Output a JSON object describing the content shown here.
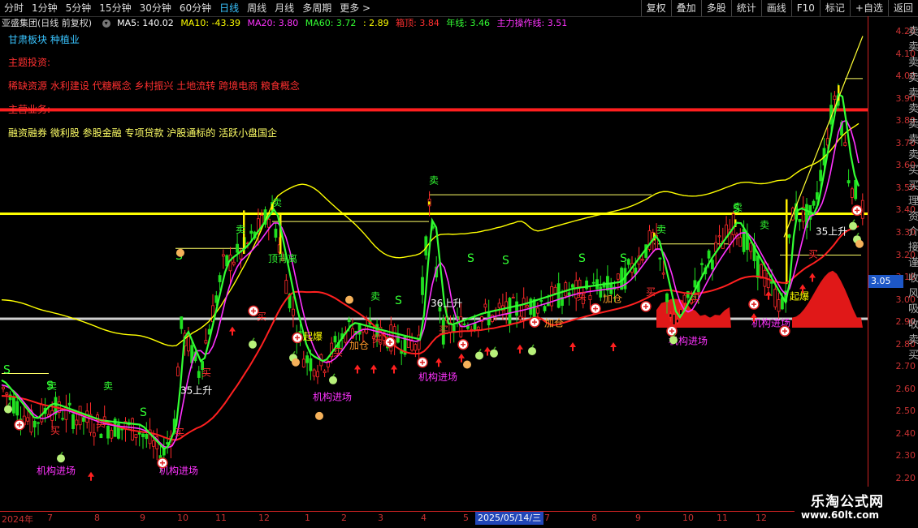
{
  "toolbar": {
    "tabs": [
      "分时",
      "1分钟",
      "5分钟",
      "15分钟",
      "30分钟",
      "60分钟",
      "日线",
      "周线",
      "月线",
      "多周期",
      "更多 >"
    ],
    "active_tab": "日线",
    "tools": [
      "复权",
      "叠加",
      "多股",
      "统计",
      "画线",
      "F10",
      "标记",
      "+自选",
      "返回"
    ]
  },
  "legend": {
    "stock": "亚盛集团(日线 前复权)",
    "ma5": "MA5: 140.02",
    "ma10": "MA10: -43.39",
    "ma20": "MA20: 3.80",
    "ma60": "MA60: 3.72",
    "extra": ": 2.89",
    "box_top": "箱顶: 3.84",
    "year_line": "年线: 3.46",
    "main_line": "主力操作线: 3.51"
  },
  "info": {
    "sector": "甘肃板块 种植业",
    "theme_label": "主题投资:",
    "themes": "稀缺资源 水利建设 代糖概念 乡村振兴 土地流转 跨境电商 粮食概念",
    "business_label": "主营业务:",
    "business": "融资融券 微利股 参股金融 专项贷款 沪股通标的 活跃小盘国企"
  },
  "annotations": {
    "institution_entry": "机构进场",
    "buy": "买",
    "sell": "卖",
    "add_position": "加仓",
    "explode": "起爆",
    "top_divergence": "顶背离",
    "rise_35": "35上升",
    "rise_36": "36上升",
    "s_mark": "S"
  },
  "price_axis": {
    "ticks": [
      "4.20",
      "4.10",
      "4.00",
      "3.90",
      "3.80",
      "3.70",
      "3.60",
      "3.50",
      "3.40",
      "3.30",
      "3.20",
      "3.10",
      "3.00",
      "2.90",
      "2.80",
      "2.70",
      "2.60",
      "2.50",
      "2.40",
      "2.30",
      "2.20"
    ],
    "current_price": "3.05",
    "side_chars": [
      "卖",
      "卖",
      "卖",
      "卖",
      "卖",
      "卖",
      "卖",
      "卖",
      "卖",
      "买",
      "买",
      "理",
      "资",
      "介",
      "接",
      "谨",
      "收",
      "风",
      "吸",
      "收",
      "卖",
      "买"
    ]
  },
  "date_axis": {
    "labels": [
      "2024年",
      "7",
      "8",
      "9",
      "10",
      "11",
      "12",
      "1",
      "2",
      "3",
      "4",
      "5",
      "2025/05/14/三",
      "7",
      "8",
      "9",
      "10",
      "11",
      "12"
    ],
    "selected_date": "2025/05/14/三"
  },
  "watermark": {
    "name": "乐淘公式网",
    "url": "www.60lt.com"
  },
  "colors": {
    "ma5": "#ffffff",
    "ma10": "#ffff00",
    "ma20": "#ff33ff",
    "ma60": "#33ff33",
    "box_top": "#ff3030",
    "year_line": "#33ff33",
    "main_line": "#ff33ff",
    "up": "#ff2a2a",
    "down": "#20e020",
    "resistance": "#ffff00",
    "support": "#d0d0d0"
  }
}
